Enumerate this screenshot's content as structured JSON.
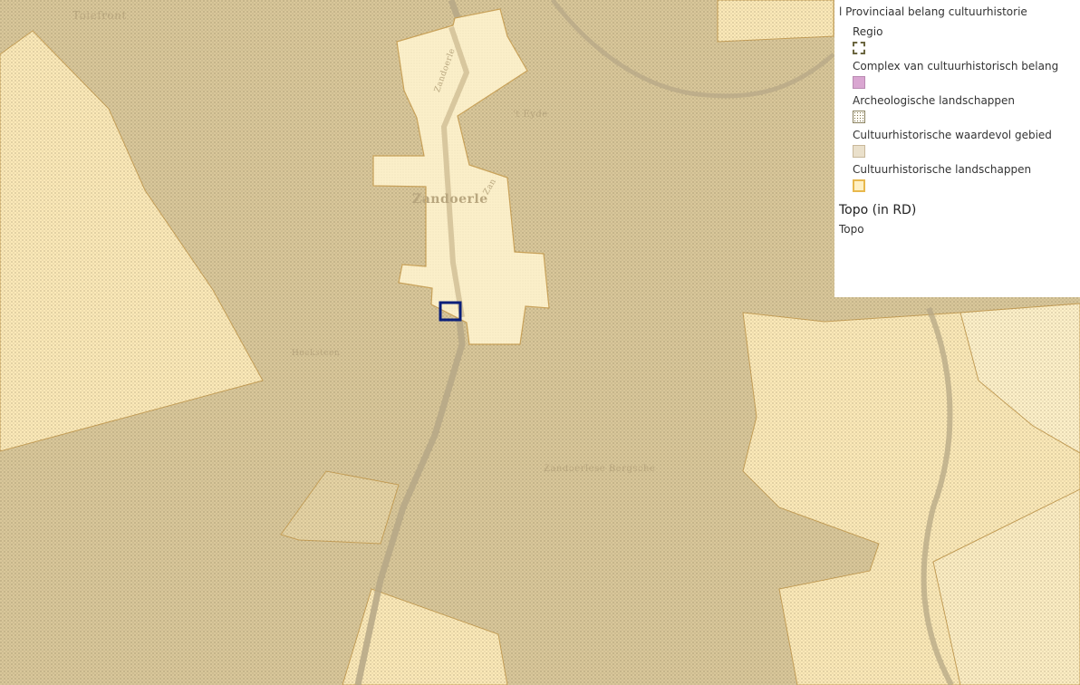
{
  "map": {
    "place_labels": [
      "Tolefront",
      "Zandoerle",
      "'t Eyde",
      "Hoeksteen",
      "Zandoerlese Bergsche"
    ],
    "street_labels": [
      "Zandoerle",
      "Zan"
    ],
    "selection_marker": "selection-square"
  },
  "legend": {
    "group_title": "l Provinciaal belang cultuurhistorie",
    "items": [
      {
        "label": "Regio",
        "swatch": "dashed-outline"
      },
      {
        "label": "Complex van cultuurhistorisch belang",
        "swatch": "pink-fill"
      },
      {
        "label": "Archeologische landschappen",
        "swatch": "dot-pattern"
      },
      {
        "label": "Cultuurhistorische waardevol gebied",
        "swatch": "beige-fill"
      },
      {
        "label": "Cultuurhistorische landschappen",
        "swatch": "yellow-fill"
      }
    ],
    "layer_title": "Topo (in RD)",
    "layer_sublabel": "Topo"
  },
  "colors": {
    "landscape_beige": "#d9c79a",
    "landscape_yellow": "#fbe9b8",
    "village_core": "#fbefc9",
    "road": "#b5a786",
    "selection_blue": "#0a1f7a",
    "legend_pink": "#d9a6d1"
  }
}
